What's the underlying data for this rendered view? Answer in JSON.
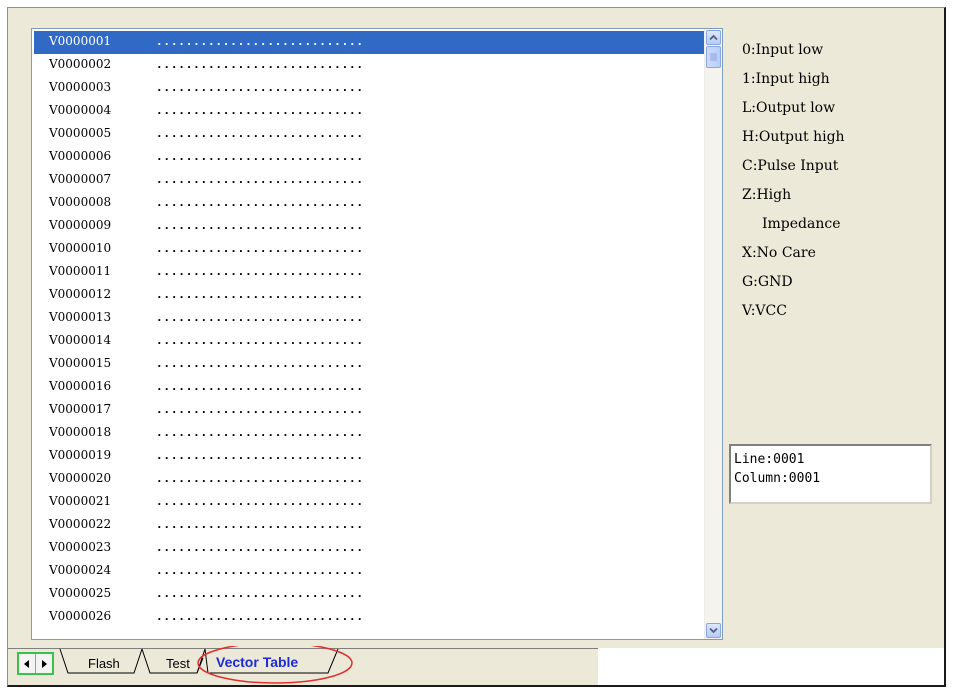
{
  "vector_rows": [
    {
      "id": "V0000001",
      "pattern": "............................",
      "selected": true
    },
    {
      "id": "V0000002",
      "pattern": "............................"
    },
    {
      "id": "V0000003",
      "pattern": "............................"
    },
    {
      "id": "V0000004",
      "pattern": "............................"
    },
    {
      "id": "V0000005",
      "pattern": "............................"
    },
    {
      "id": "V0000006",
      "pattern": "............................"
    },
    {
      "id": "V0000007",
      "pattern": "............................"
    },
    {
      "id": "V0000008",
      "pattern": "............................"
    },
    {
      "id": "V0000009",
      "pattern": "............................"
    },
    {
      "id": "V0000010",
      "pattern": "............................"
    },
    {
      "id": "V0000011",
      "pattern": "............................"
    },
    {
      "id": "V0000012",
      "pattern": "............................"
    },
    {
      "id": "V0000013",
      "pattern": "............................"
    },
    {
      "id": "V0000014",
      "pattern": "............................"
    },
    {
      "id": "V0000015",
      "pattern": "............................"
    },
    {
      "id": "V0000016",
      "pattern": "............................"
    },
    {
      "id": "V0000017",
      "pattern": "............................"
    },
    {
      "id": "V0000018",
      "pattern": "............................"
    },
    {
      "id": "V0000019",
      "pattern": "............................"
    },
    {
      "id": "V0000020",
      "pattern": "............................"
    },
    {
      "id": "V0000021",
      "pattern": "............................"
    },
    {
      "id": "V0000022",
      "pattern": "............................"
    },
    {
      "id": "V0000023",
      "pattern": "............................"
    },
    {
      "id": "V0000024",
      "pattern": "............................"
    },
    {
      "id": "V0000025",
      "pattern": "............................"
    },
    {
      "id": "V0000026",
      "pattern": "............................"
    }
  ],
  "legend": [
    {
      "text": "0:Input low"
    },
    {
      "text": "1:Input high"
    },
    {
      "text": "L:Output low"
    },
    {
      "text": "H:Output high"
    },
    {
      "text": "C:Pulse Input"
    },
    {
      "text": "Z:High"
    },
    {
      "text": "Impedance",
      "continuation": true
    },
    {
      "text": "X:No Care"
    },
    {
      "text": "G:GND"
    },
    {
      "text": "V:VCC"
    }
  ],
  "cursor_position": {
    "line": "Line:0001",
    "column": "Column:0001"
  },
  "tabs": {
    "nav_prev": "◂",
    "nav_next": "▸",
    "items": [
      {
        "label": "Flash"
      },
      {
        "label": "Test"
      },
      {
        "label": "Vector Table",
        "active": true
      }
    ]
  },
  "icons": {
    "scroll_up": "chevron-up-icon",
    "scroll_down": "chevron-down-icon",
    "scroll_thumb": "grip-icon"
  },
  "colors": {
    "selection": "#316ac5",
    "active_tab_text": "#1d2bd8",
    "highlight_ellipse": "#e03030",
    "nav_border": "#39c24a"
  }
}
